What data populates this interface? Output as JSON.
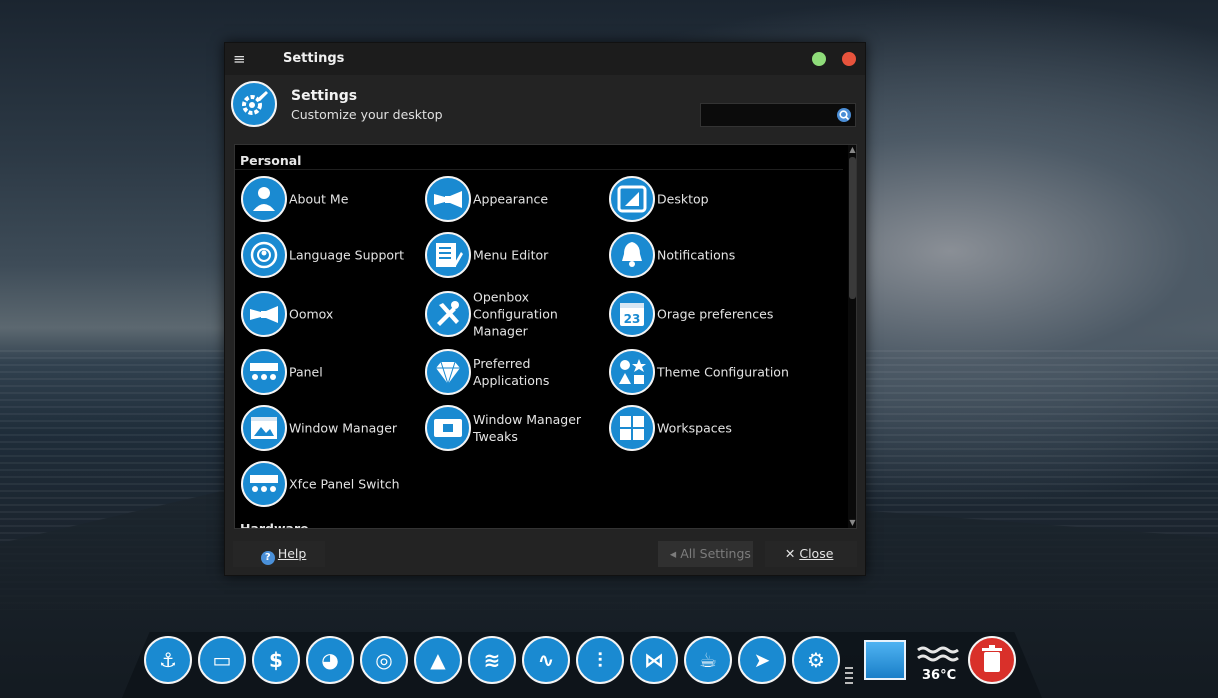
{
  "window": {
    "title": "Settings",
    "header_title": "Settings",
    "header_subtitle": "Customize your desktop",
    "search_placeholder": ""
  },
  "categories": [
    "Personal",
    "Hardware"
  ],
  "items": [
    {
      "label": "About Me",
      "icon": "user-icon"
    },
    {
      "label": "Appearance",
      "icon": "bowtie-icon"
    },
    {
      "label": "Desktop",
      "icon": "desktop-icon"
    },
    {
      "label": "Language Support",
      "icon": "globe-icon"
    },
    {
      "label": "Menu Editor",
      "icon": "menu-editor-icon"
    },
    {
      "label": "Notifications",
      "icon": "bell-icon"
    },
    {
      "label": "Oomox",
      "icon": "bowtie-icon"
    },
    {
      "label": "Openbox\nConfiguration\nManager",
      "icon": "tools-icon"
    },
    {
      "label": "Orage preferences",
      "icon": "calendar-icon"
    },
    {
      "label": "Panel",
      "icon": "panel-icon"
    },
    {
      "label": "Preferred Applications",
      "icon": "diamond-icon"
    },
    {
      "label": "Theme Configuration",
      "icon": "shapes-icon"
    },
    {
      "label": "Window Manager",
      "icon": "window-image-icon"
    },
    {
      "label": "Window Manager\nTweaks",
      "icon": "window-tweaks-icon"
    },
    {
      "label": "Workspaces",
      "icon": "workspaces-icon"
    },
    {
      "label": "Xfce Panel Switch",
      "icon": "panel-icon"
    }
  ],
  "buttons": {
    "help": "Help",
    "all_settings": "All Settings",
    "close": "Close"
  },
  "dock": {
    "apps": [
      "anchor-icon",
      "package-icon",
      "money-icon",
      "firefox-icon",
      "chrome-icon",
      "vlc-icon",
      "spotify-icon",
      "audio-wave-icon",
      "equalizer-icon",
      "vscode-icon",
      "teapot-icon",
      "telegram-icon",
      "settings-icon"
    ],
    "temperature": "36°C"
  },
  "colors": {
    "accent": "#1a8ad1",
    "close": "#e7533c",
    "maximize": "#8fdc7a",
    "trash": "#d9302a"
  }
}
